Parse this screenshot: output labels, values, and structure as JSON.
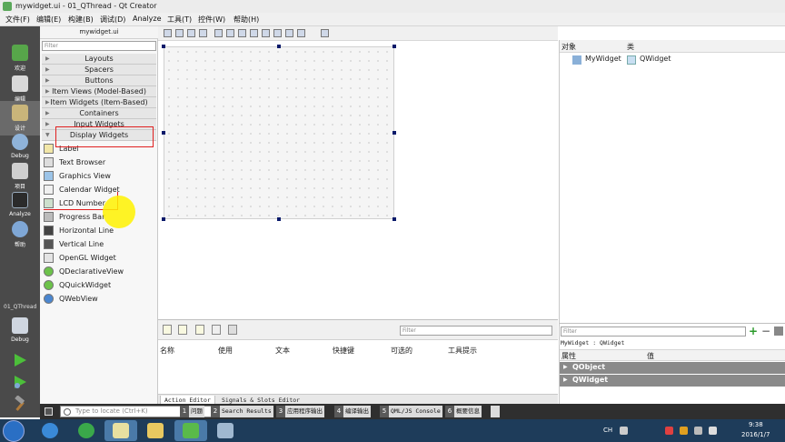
{
  "window": {
    "title": "mywidget.ui - 01_QThread - Qt Creator"
  },
  "menubar": {
    "items": [
      "文件(F)",
      "编辑(E)",
      "构建(B)",
      "调试(D)",
      "Analyze",
      "工具(T)",
      "控件(W)",
      "帮助(H)"
    ]
  },
  "modebar": {
    "modes": [
      "欢迎",
      "编辑",
      "设计",
      "Debug",
      "项目",
      "Analyze",
      "帮助"
    ],
    "active_mode": "设计",
    "project": "01_QThread",
    "kit_label": "Debug"
  },
  "widgetbox": {
    "header": "mywidget.ui",
    "filter_placeholder": "Filter",
    "categories": [
      "Layouts",
      "Spacers",
      "Buttons",
      "Item Views (Model-Based)",
      "Item Widgets (Item-Based)",
      "Containers",
      "Input Widgets",
      "Display Widgets"
    ],
    "expanded_category": "Display Widgets",
    "items": [
      "Label",
      "Text Browser",
      "Graphics View",
      "Calendar Widget",
      "LCD Number",
      "Progress Bar",
      "Horizontal Line",
      "Vertical Line",
      "OpenGL Widget",
      "QDeclarativeView",
      "QQuickWidget",
      "QWebView"
    ]
  },
  "action_editor": {
    "filter_placeholder": "Filter",
    "columns": [
      "名称",
      "使用",
      "文本",
      "快捷键",
      "可选的",
      "工具提示"
    ],
    "tabs": [
      "Action Editor",
      "Signals & Slots Editor"
    ],
    "active_tab": "Action Editor"
  },
  "object_inspector": {
    "col_object": "对象",
    "col_class": "类",
    "rows": [
      {
        "object": "MyWidget",
        "class": "QWidget"
      }
    ]
  },
  "property_editor": {
    "filter_placeholder": "Filter",
    "class_label": "MyWidget : QWidget",
    "col_property": "属性",
    "col_value": "值",
    "groups": [
      "QObject",
      "QWidget"
    ]
  },
  "output_bar": {
    "locator_placeholder": "Type to locate (Ctrl+K)",
    "panes": [
      {
        "num": "1",
        "label": "问题"
      },
      {
        "num": "2",
        "label": "Search Results"
      },
      {
        "num": "3",
        "label": "应用程序输出"
      },
      {
        "num": "4",
        "label": "编译输出"
      },
      {
        "num": "5",
        "label": "QML/JS Console"
      },
      {
        "num": "6",
        "label": "概要信息"
      }
    ]
  },
  "taskbar": {
    "ime": "CH",
    "time": "9:38",
    "date": "2016/1/7"
  },
  "colors": {
    "mode_bar": "#4a4a4a",
    "highlight_box": "#e02020",
    "cursor_highlight": "#fff200",
    "taskbar": "#1e3c5a",
    "property_group": "#8a8a8a"
  }
}
